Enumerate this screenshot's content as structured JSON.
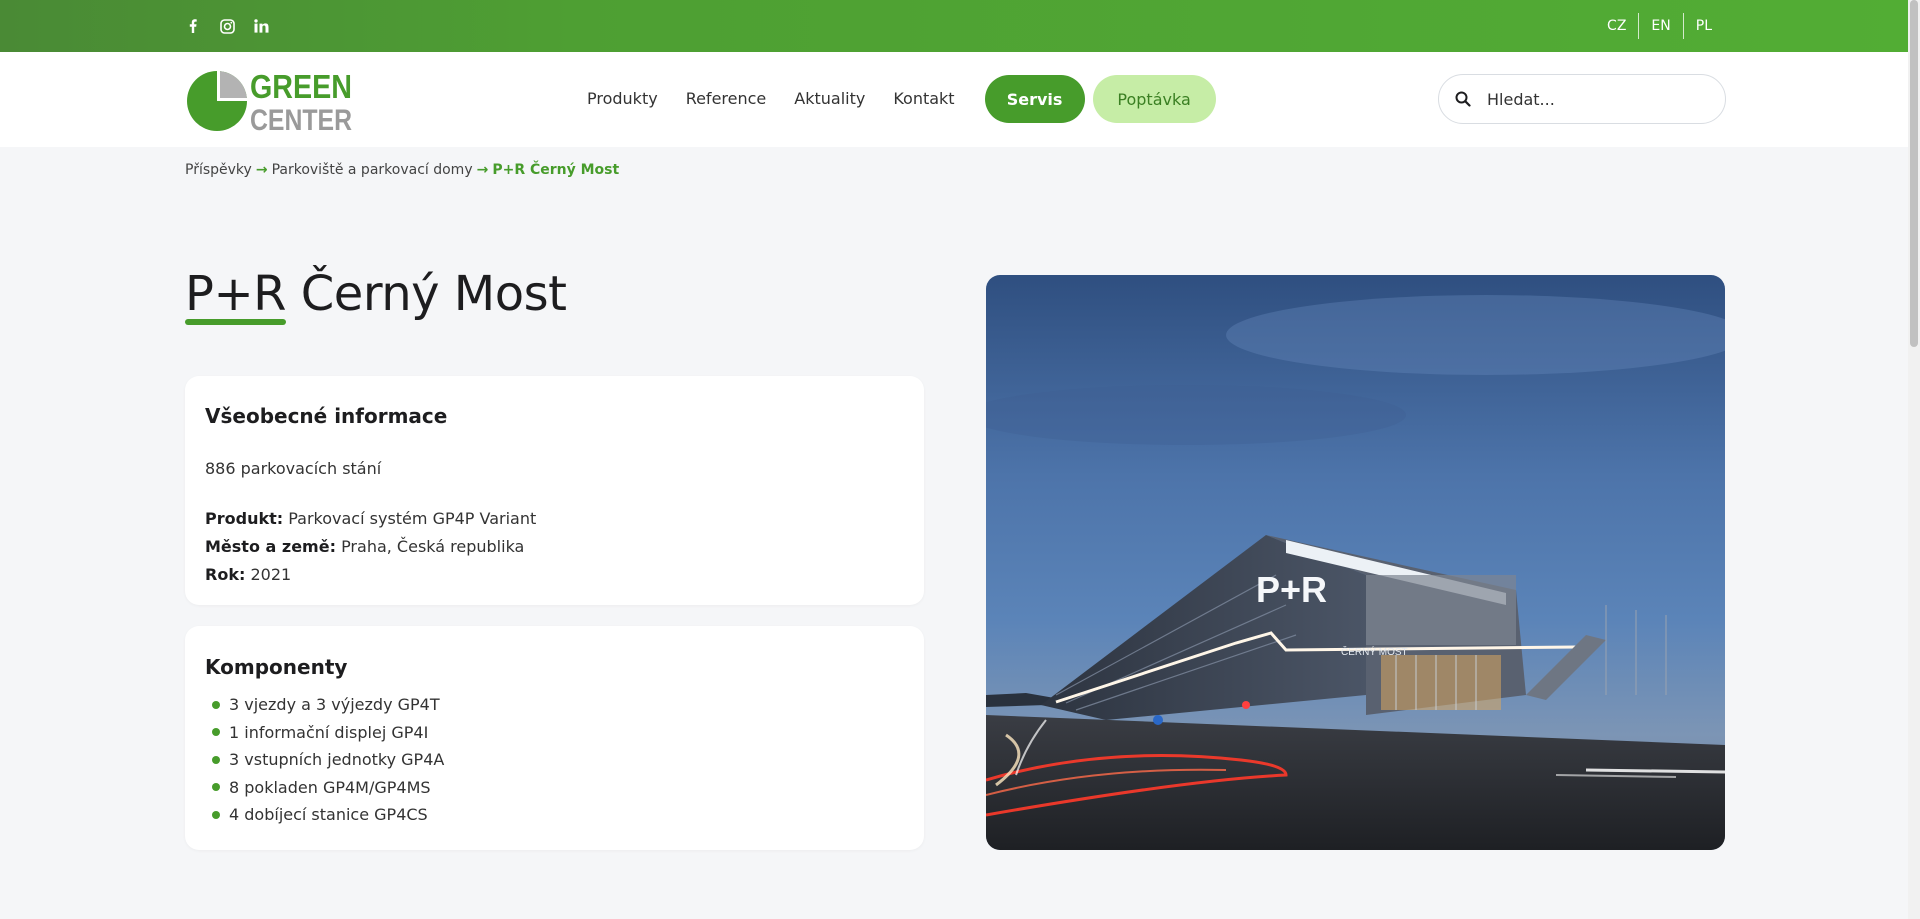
{
  "social": {
    "icons": [
      "facebook-icon",
      "instagram-icon",
      "linkedin-icon"
    ]
  },
  "languages": [
    "CZ",
    "EN",
    "PL"
  ],
  "logo": {
    "line1": "GREEN",
    "line2": "CENTER"
  },
  "nav": {
    "items": [
      "Produkty",
      "Reference",
      "Aktuality",
      "Kontakt"
    ],
    "servis_label": "Servis",
    "poptavka_label": "Poptávka"
  },
  "search": {
    "placeholder": "Hledat..."
  },
  "breadcrumb": {
    "items": [
      "Příspěvky",
      "Parkoviště a parkovací domy",
      "P+R Černý Most"
    ],
    "separator": "→"
  },
  "page": {
    "title": "P+R Černý Most"
  },
  "general_info": {
    "heading": "Všeobecné informace",
    "spaces": "886 parkovacích stání",
    "product_label": "Produkt:",
    "product_value": "Parkovací systém GP4P Variant",
    "city_label": "Město a země:",
    "city_value": "Praha, Česká republika",
    "year_label": "Rok:",
    "year_value": "2021"
  },
  "components": {
    "heading": "Komponenty",
    "items": [
      "3 vjezdy a 3 výjezdy GP4T",
      "1 informační displej GP4I",
      "3 vstupních jednotky GP4A",
      "8 pokladen GP4M/GP4MS",
      "4 dobíjecí stanice GP4CS"
    ]
  },
  "photo": {
    "sign_text": "P+R",
    "building_label": "ČERNÝ MOST"
  },
  "colors": {
    "brand_green": "#479c2b",
    "light_green": "#c6eda6",
    "topbar_green": "#52ad34"
  }
}
